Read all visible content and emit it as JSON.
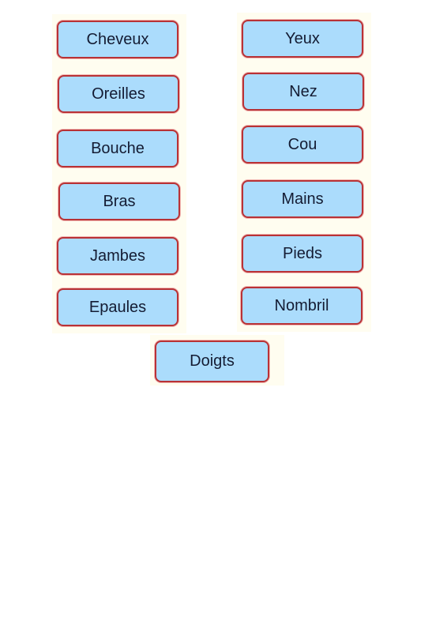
{
  "cards": {
    "left": [
      "Cheveux",
      "Oreilles",
      "Bouche",
      "Bras",
      "Jambes",
      "Epaules"
    ],
    "right": [
      "Yeux",
      "Nez",
      "Cou",
      "Mains",
      "Pieds",
      "Nombril"
    ],
    "bottom": "Doigts"
  },
  "colors": {
    "card_fill": "#abdcfc",
    "card_border": "#b83236",
    "text": "#141c33"
  }
}
